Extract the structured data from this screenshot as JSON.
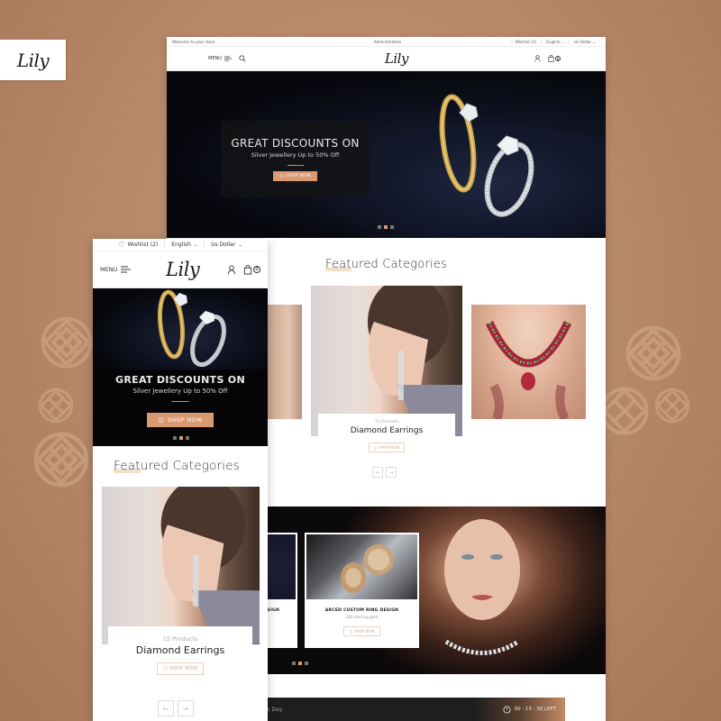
{
  "brand": {
    "logo_text": "Lily"
  },
  "desktop": {
    "topbar": {
      "welcome": "Welcome to your store",
      "center_link": "Administration",
      "wishlist": "Wishlist (2)",
      "language": "English",
      "currency": "Us Dollar"
    },
    "header": {
      "menu_label": "MENU",
      "logo_text": "Lily",
      "cart_count": "0"
    },
    "hero": {
      "title": "GREAT DISCOUNTS ON",
      "subtitle": "Silver Jewellery Up to 50% Off",
      "button_label": "SHOP NOW",
      "slides": 3,
      "active_slide": 2
    },
    "featured": {
      "title_highlight": "Feat",
      "title_rest": "ured Categories",
      "active_card": {
        "count": "15 Products",
        "name": "Diamond Earrings",
        "button_label": "SHOP NOW"
      }
    },
    "products": {
      "partial_card_title": "ESIGN",
      "card": {
        "title": "ARCED CUSTOM RING DESIGN",
        "subtitle": "20k sterling gold",
        "button_label": "SHOP NOW"
      },
      "slides": 3,
      "active_slide": 2
    },
    "deal": {
      "label": "he Day",
      "timer": "00 : 13 : 30 LEFT"
    }
  },
  "mobile": {
    "topbar": {
      "wishlist": "Wishlist (2)",
      "language": "English",
      "currency": "Us Dollar"
    },
    "header": {
      "menu_label": "MENU",
      "logo_text": "Lily",
      "cart_count": "0"
    },
    "hero": {
      "title": "GREAT DISCOUNTS ON",
      "subtitle": "Silver Jewellery Up to 50% Off",
      "button_label": "SHOP NOW",
      "slides": 3,
      "active_slide": 2
    },
    "featured": {
      "title_highlight": "Feat",
      "title_rest": "ured Categories",
      "card": {
        "count": "15 Products",
        "name": "Diamond Earrings",
        "button_label": "SHOP NOW"
      }
    }
  },
  "colors": {
    "accent": "#d99a72",
    "background": "#b98a6b",
    "dark": "#07080d"
  }
}
